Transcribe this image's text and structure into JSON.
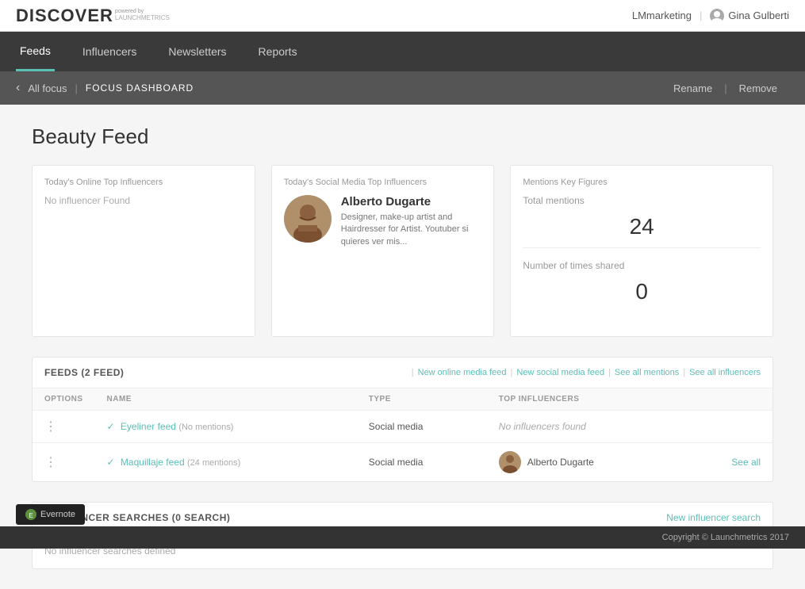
{
  "topbar": {
    "brand": "DISCOVER",
    "powered_by": "powered by",
    "launchmetrics": "LAUNCHMETRICS",
    "account": "LMmarketing",
    "user": "Gina Gulberti"
  },
  "nav": {
    "items": [
      {
        "id": "feeds",
        "label": "Feeds",
        "active": true
      },
      {
        "id": "influencers",
        "label": "Influencers",
        "active": false
      },
      {
        "id": "newsletters",
        "label": "Newsletters",
        "active": false
      },
      {
        "id": "reports",
        "label": "Reports",
        "active": false
      }
    ]
  },
  "breadcrumb": {
    "back_label": "All focus",
    "current": "FOCUS DASHBOARD",
    "rename": "Rename",
    "remove": "Remove"
  },
  "page": {
    "title": "Beauty Feed"
  },
  "online_influencers": {
    "title": "Today's Online Top Influencers",
    "empty_msg": "No influencer Found"
  },
  "social_influencers": {
    "title": "Today's Social Media Top Influencers",
    "name": "Alberto Dugarte",
    "bio": "Designer, make-up artist and Hairdresser for Artist. Youtuber si quieres ver mis..."
  },
  "mentions": {
    "title": "Mentions Key Figures",
    "total_label": "Total mentions",
    "total_value": "24",
    "shared_label": "Number of times shared",
    "shared_value": "0"
  },
  "feeds": {
    "title": "FEEDS",
    "count": "(2 feed)",
    "actions": {
      "new_online": "New online media feed",
      "new_social": "New social media feed",
      "see_mentions": "See all mentions",
      "see_influencers": "See all influencers"
    },
    "table_headers": [
      "OPTIONS",
      "NAME",
      "TYPE",
      "TOP INFLUENCERS"
    ],
    "rows": [
      {
        "name": "Eyeliner feed",
        "mentions": "(No mentions)",
        "type": "Social media",
        "top_influencer": null,
        "no_influencer_text": "No influencers found"
      },
      {
        "name": "Maquillaje feed",
        "mentions": "(24 mentions)",
        "type": "Social media",
        "top_influencer": "Alberto Dugarte",
        "no_influencer_text": null,
        "see_all": "See all"
      }
    ]
  },
  "searches": {
    "title": "INFLUENCER SEARCHES",
    "count": "(0 search)",
    "action": "New influencer search",
    "empty_msg": "No influencer searches defined"
  },
  "footer": {
    "copyright": "Copyright © Launchmetrics 2017"
  },
  "evernote": {
    "label": "Evernote"
  }
}
